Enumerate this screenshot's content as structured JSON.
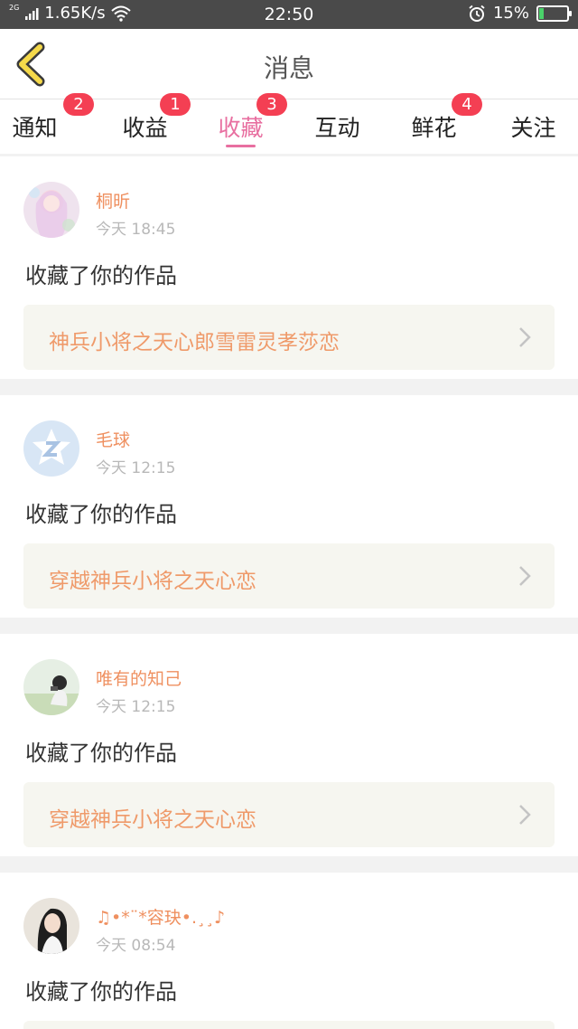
{
  "status_bar": {
    "network_type": "2G",
    "speed": "1.65K/s",
    "time": "22:50",
    "battery": "15%",
    "battery_level": 0.15
  },
  "header": {
    "title": "消息"
  },
  "tabs": [
    {
      "label": "通知",
      "badge": "2"
    },
    {
      "label": "收益",
      "badge": "1"
    },
    {
      "label": "收藏",
      "badge": "3",
      "active": true
    },
    {
      "label": "互动",
      "badge": ""
    },
    {
      "label": "鲜花",
      "badge": "4"
    },
    {
      "label": "关注",
      "badge": ""
    }
  ],
  "feed": [
    {
      "username": "桐昕",
      "time": "今天 18:45",
      "action": "收藏了你的作品",
      "work_title": "神兵小将之天心郎雪雷灵孝莎恋"
    },
    {
      "username": "毛球",
      "time": "今天 12:15",
      "action": "收藏了你的作品",
      "work_title": "穿越神兵小将之天心恋"
    },
    {
      "username": "唯有的知己",
      "time": "今天 12:15",
      "action": "收藏了你的作品",
      "work_title": "穿越神兵小将之天心恋"
    },
    {
      "username": "♫•*¨*容玦•.¸¸♪",
      "time": "今天 08:54",
      "action": "收藏了你的作品",
      "work_title": ""
    }
  ],
  "colors": {
    "accent_pink": "#e86fa0",
    "username_orange": "#ef9060",
    "badge_red": "#f43f53",
    "back_arrow_yellow": "#f5d94a"
  }
}
